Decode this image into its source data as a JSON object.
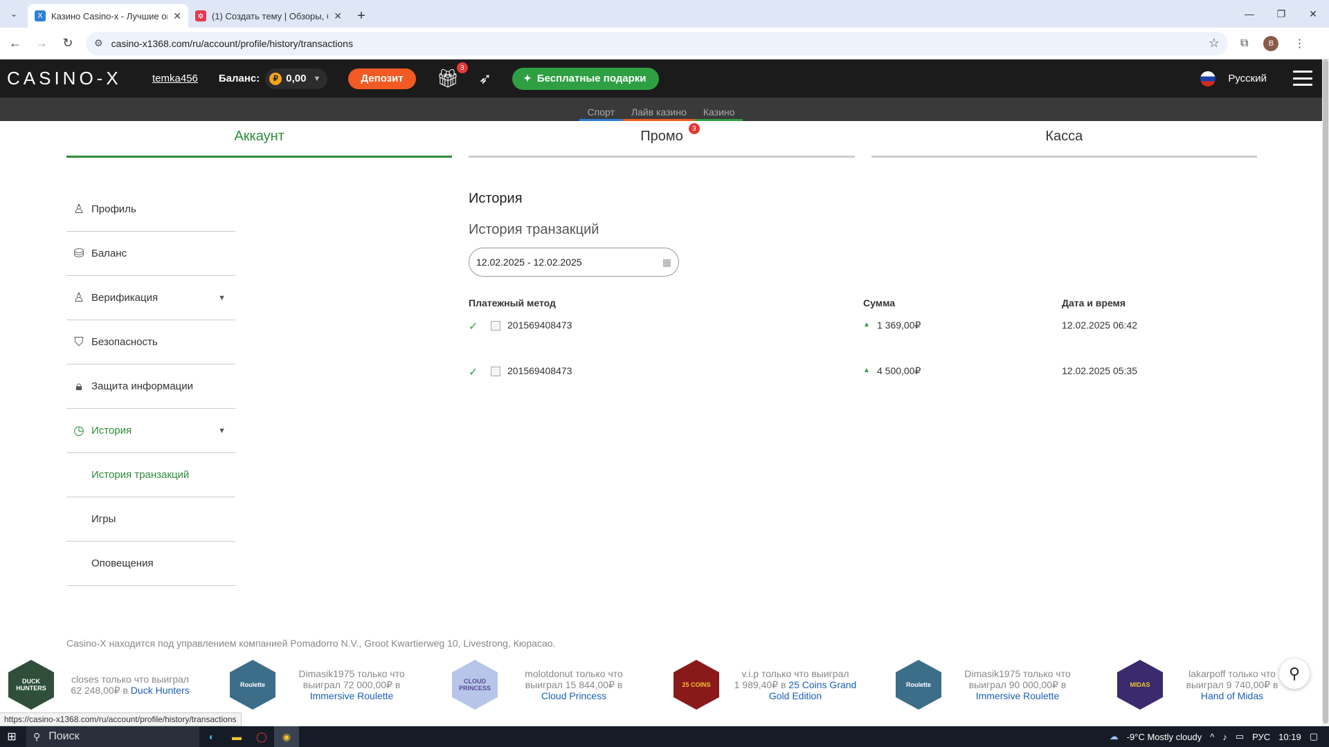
{
  "browser": {
    "tabs": [
      {
        "title": "Казино Casino-x - Лучшие он",
        "active": true,
        "favicon": "casino-x-icon"
      },
      {
        "title": "(1) Создать тему | Обзоры, бо",
        "active": false,
        "favicon": "forum-icon"
      }
    ],
    "url": "casino-x1368.com/ru/account/profile/history/transactions",
    "profile_initial": "B"
  },
  "header": {
    "logo": "CASINO-X",
    "username": "temka456",
    "balance_label": "Баланс:",
    "balance_value": "0,00",
    "currency_symbol": "₽",
    "deposit_label": "Депозит",
    "gift_badge": "3",
    "free_gifts_label": "Бесплатные подарки",
    "language": "Русский"
  },
  "subnav": [
    {
      "label": "Спорт",
      "color": "#2f7fd6"
    },
    {
      "label": "Лайв казино",
      "color": "#f15a22"
    },
    {
      "label": "Казино",
      "color": "#2ea043"
    }
  ],
  "account_tabs": [
    {
      "label": "Аккаунт",
      "active": true
    },
    {
      "label": "Промо",
      "badge": "3"
    },
    {
      "label": "Касса"
    }
  ],
  "side_menu": [
    {
      "label": "Профиль",
      "icon": "user-icon"
    },
    {
      "label": "Баланс",
      "icon": "coins-icon"
    },
    {
      "label": "Верификация",
      "icon": "verify-icon",
      "expandable": true
    },
    {
      "label": "Безопасность",
      "icon": "shield-icon"
    },
    {
      "label": "Защита информации",
      "icon": "lock-icon"
    },
    {
      "label": "История",
      "icon": "history-icon",
      "expandable": true,
      "active": true
    },
    {
      "label": "История транзакций",
      "sub": true,
      "active": true
    },
    {
      "label": "Игры",
      "sub": true
    },
    {
      "label": "Оповещения",
      "sub": true
    }
  ],
  "main": {
    "title": "История",
    "subtitle": "История транзакций",
    "date_range": "12.02.2025 - 12.02.2025",
    "columns": [
      "Платежный метод",
      "Сумма",
      "Дата и время"
    ],
    "rows": [
      {
        "method": "201569408473",
        "amount": "1 369,00₽",
        "datetime": "12.02.2025 06:42"
      },
      {
        "method": "201569408473",
        "amount": "4 500,00₽",
        "datetime": "12.02.2025 05:35"
      }
    ]
  },
  "footer": {
    "legal": "Casino-X находится под управлением компанией Pomadorro N.V., Groot Kwartierweg 10, Livestrong, Кюрасао.",
    "winners": [
      {
        "line1": "closes только что выиграл",
        "line2": "62 248,00₽ в",
        "game": "Duck Hunters",
        "thumb_color": "#2f4f3a",
        "thumb_text": "DUCK HUNTERS"
      },
      {
        "line1": "Dimasik1975 только что",
        "line2": "выиграл 72 000,00₽ в",
        "game": "Immersive Roulette",
        "thumb_color": "#3c6e8a",
        "thumb_text": "Roulette"
      },
      {
        "line1": "molotdonut только что",
        "line2": "выиграл 15 844,00₽ в",
        "game": "Cloud Princess",
        "thumb_color": "#b7c6e8",
        "thumb_text": "CLOUD PRINCESS"
      },
      {
        "line1": "v.i.p только что выиграл",
        "line2": "1 989,40₽ в",
        "game": "25 Coins Grand Gold Edition",
        "thumb_color": "#8a1a1a",
        "thumb_text": "25 COINS"
      },
      {
        "line1": "Dimasik1975 только что",
        "line2": "выиграл 90 000,00₽ в",
        "game": "Immersive Roulette",
        "thumb_color": "#3c6e8a",
        "thumb_text": "Roulette"
      },
      {
        "line1": "lakarpoff только что",
        "line2": "выиграл 9 740,00₽ в",
        "game": "Hand of Midas",
        "thumb_color": "#3b2a6e",
        "thumb_text": "MIDAS"
      }
    ]
  },
  "status_url": "https://casino-x1368.com/ru/account/profile/history/transactions",
  "taskbar": {
    "search_label": "Поиск",
    "weather": "-9°C  Mostly cloudy",
    "lang": "РУС",
    "time": "10:19"
  }
}
